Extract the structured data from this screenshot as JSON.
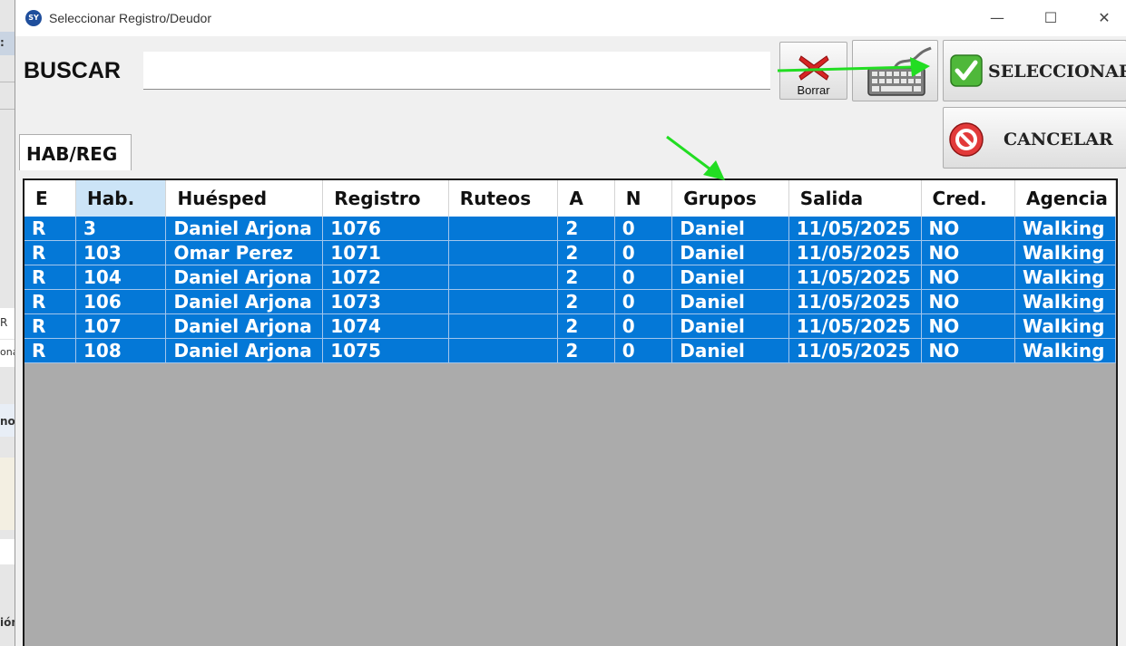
{
  "window": {
    "title": "Seleccionar Registro/Deudor",
    "icon_text": "SY",
    "minimize": "—",
    "maximize": "☐",
    "close": "✕"
  },
  "background": {
    "fragments": [
      ":",
      "R",
      "ona",
      "nos",
      "ión"
    ]
  },
  "search": {
    "label": "BUSCAR",
    "value": "",
    "placeholder": ""
  },
  "toolbar": {
    "borrar_label": "Borrar",
    "keyboard_icon": "keyboard-icon",
    "select_label": "SELECCIONAR",
    "cancel_label": "CANCELAR"
  },
  "tab": {
    "label": "HAB/REG"
  },
  "table": {
    "columns": [
      "E",
      "Hab.",
      "Huésped",
      "Registro",
      "Ruteos",
      "A",
      "N",
      "Grupos",
      "Salida",
      "Cred.",
      "Agencia"
    ],
    "active_column": "Hab.",
    "rows": [
      [
        "R",
        "3",
        "Daniel  Arjona",
        "1076",
        "",
        "2",
        "0",
        "Daniel",
        "11/05/2025",
        "NO",
        "Walking"
      ],
      [
        "R",
        "103",
        "Omar  Perez",
        "1071",
        "",
        "2",
        "0",
        "Daniel",
        "11/05/2025",
        "NO",
        "Walking"
      ],
      [
        "R",
        "104",
        "Daniel  Arjona",
        "1072",
        "",
        "2",
        "0",
        "Daniel",
        "11/05/2025",
        "NO",
        "Walking"
      ],
      [
        "R",
        "106",
        "Daniel  Arjona",
        "1073",
        "",
        "2",
        "0",
        "Daniel",
        "11/05/2025",
        "NO",
        "Walking"
      ],
      [
        "R",
        "107",
        "Daniel  Arjona",
        "1074",
        "",
        "2",
        "0",
        "Daniel",
        "11/05/2025",
        "NO",
        "Walking"
      ],
      [
        "R",
        "108",
        "Daniel  Arjona",
        "1075",
        "",
        "2",
        "0",
        "Daniel",
        "11/05/2025",
        "NO",
        "Walking"
      ]
    ]
  },
  "colors": {
    "selection": "#0478d7",
    "header_active": "#cce4f7",
    "grid_background": "#ababab",
    "annotation_arrow": "#22dd22"
  }
}
